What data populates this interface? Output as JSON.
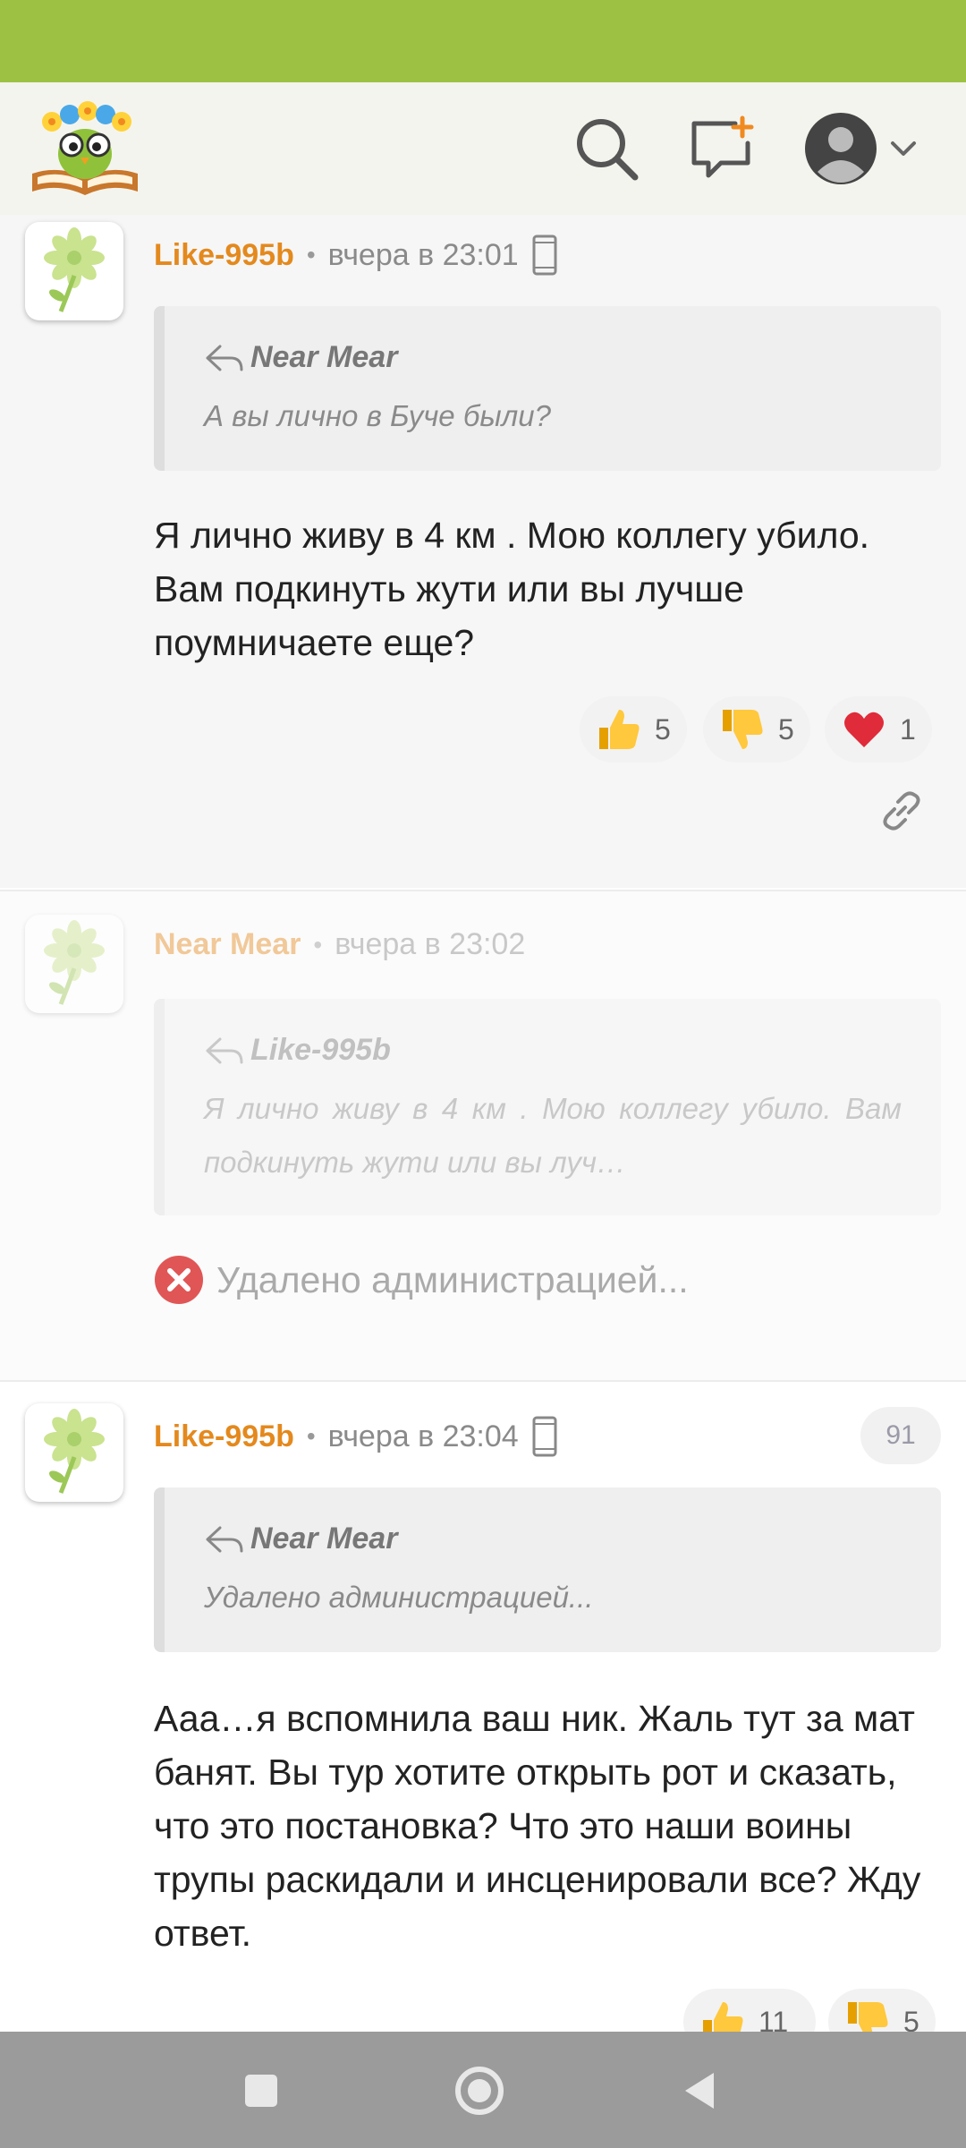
{
  "colors": {
    "status_bar": "#9dc243",
    "author": "#e4891d",
    "deleted_icon": "#e05656"
  },
  "header": {
    "logo_icon": "owl-on-book-logo",
    "search_icon": "search-icon",
    "new_post_icon": "new-post-icon",
    "profile_icon": "user-avatar-icon",
    "menu_icon": "chevron-down-icon"
  },
  "comments": [
    {
      "author": "Like-995b",
      "time": "вчера в 23:01",
      "quote": {
        "author": "Near Mear",
        "text": "А вы лично в Буче были?"
      },
      "body": "Я лично живу в 4 км . Мою коллегу убило. Вам подкинуть жути или вы лучше поумничаете еще?",
      "reactions": {
        "likes": "5",
        "dislikes": "5",
        "hearts": "1"
      }
    },
    {
      "author": "Near Mear",
      "time": "вчера в 23:02",
      "quote": {
        "author": "Like-995b",
        "text": "Я лично живу в 4 км . Мою коллегу убило. Вам подкинуть жути или вы луч…"
      },
      "deleted_text": "Удалено администрацией..."
    },
    {
      "author": "Like-995b",
      "time": "вчера в 23:04",
      "badge": "91",
      "quote": {
        "author": "Near Mear",
        "text": "Удалено администрацией..."
      },
      "body": "Ааа…я вспомнила ваш ник. Жаль тут за мат банят. Вы тур хотите открыть рот и сказать, что это постановка? Что это наши воины трупы раскидали и инсценировали все? Жду ответ.",
      "reactions": {
        "likes": "11",
        "dislikes": "5"
      }
    }
  ],
  "nav": {
    "recents": "square-icon",
    "home": "circle-icon",
    "back": "triangle-back-icon"
  }
}
